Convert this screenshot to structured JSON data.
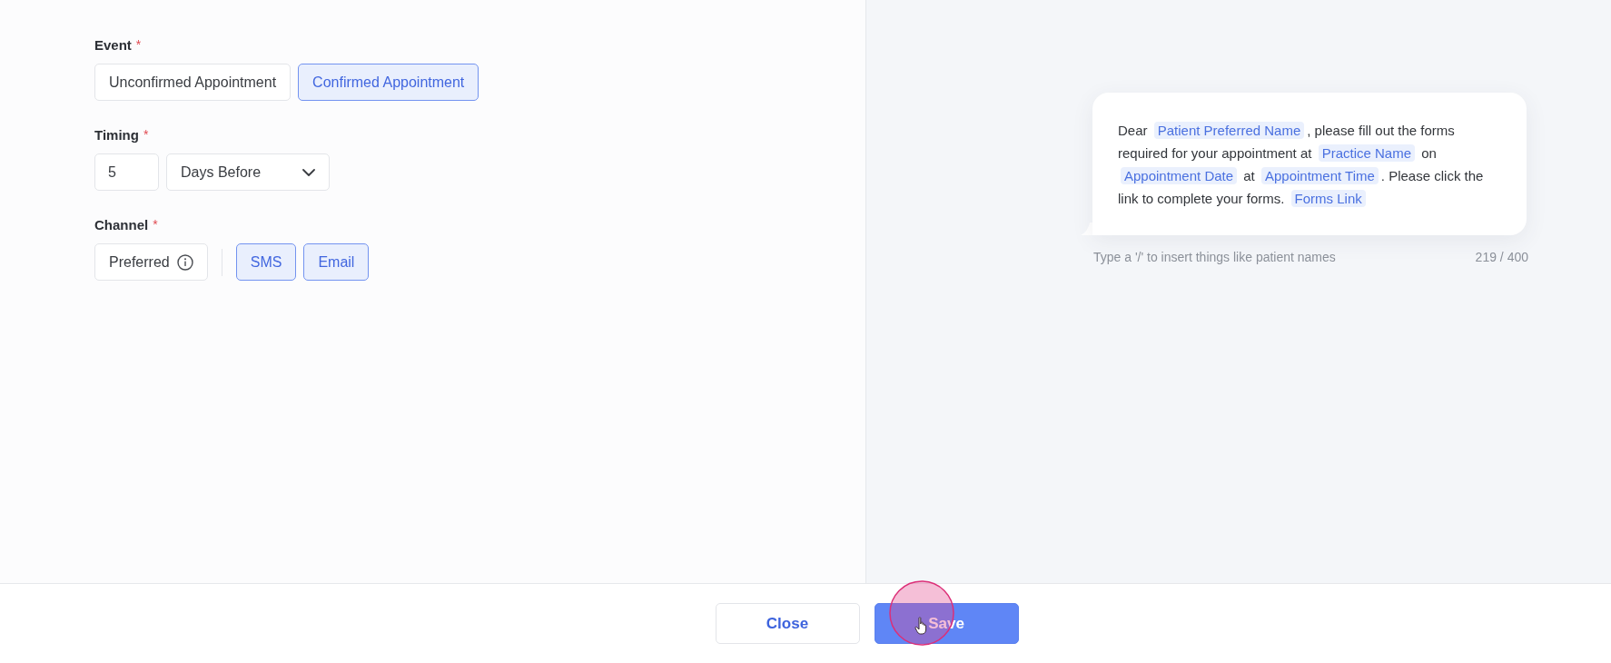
{
  "event": {
    "label": "Event",
    "required_mark": "*",
    "options": [
      {
        "label": "Unconfirmed Appointment",
        "selected": false
      },
      {
        "label": "Confirmed Appointment",
        "selected": true
      }
    ]
  },
  "timing": {
    "label": "Timing",
    "required_mark": "*",
    "amount": "5",
    "unit": "Days Before"
  },
  "channel": {
    "label": "Channel",
    "required_mark": "*",
    "preferred": {
      "label": "Preferred",
      "selected": false
    },
    "options": [
      {
        "label": "SMS",
        "selected": true
      },
      {
        "label": "Email",
        "selected": true
      }
    ]
  },
  "message": {
    "segments": [
      {
        "kind": "text",
        "text": "Dear "
      },
      {
        "kind": "variable",
        "text": "Patient Preferred Name"
      },
      {
        "kind": "text",
        "text": ", please fill out the forms required for your appointment at "
      },
      {
        "kind": "variable",
        "text": "Practice Name"
      },
      {
        "kind": "text",
        "text": " on "
      },
      {
        "kind": "variable",
        "text": "Appointment Date"
      },
      {
        "kind": "text",
        "text": " at "
      },
      {
        "kind": "variable",
        "text": "Appointment Time"
      },
      {
        "kind": "text",
        "text": ". Please click the link to complete your forms. "
      },
      {
        "kind": "variable",
        "text": "Forms Link"
      }
    ],
    "hint": "Type a '/' to insert things like patient names",
    "count": "219 / 400"
  },
  "footer": {
    "buttons": [
      {
        "label": "Close",
        "kind": "secondary"
      },
      {
        "label": "Save",
        "kind": "primary"
      }
    ]
  }
}
